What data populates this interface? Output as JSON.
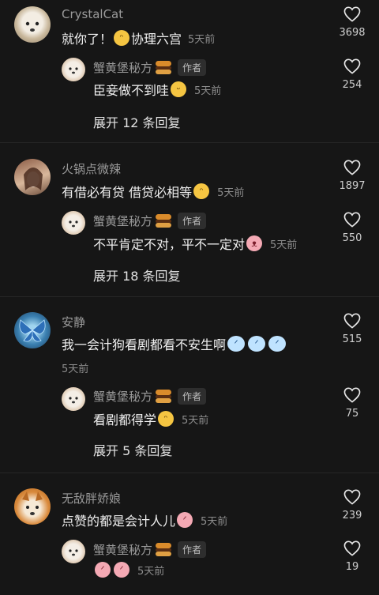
{
  "comments": [
    {
      "user": "CrystalCat",
      "text": "就你了！",
      "text2": "协理六宫",
      "time": "5天前",
      "likes": "3698",
      "reply": {
        "user": "蟹黄堡秘方",
        "badge": "作者",
        "text": "臣妾做不到哇",
        "time": "5天前",
        "likes": "254"
      },
      "expand": "展开 12 条回复"
    },
    {
      "user": "火锅点微辣",
      "text": "有借必有贷 借贷必相等",
      "time": "5天前",
      "likes": "1897",
      "reply": {
        "user": "蟹黄堡秘方",
        "badge": "作者",
        "text": "不平肯定不对，平不一定对",
        "time": "5天前",
        "likes": "550"
      },
      "expand": "展开 18 条回复"
    },
    {
      "user": "安静",
      "text": "我一会计狗看剧都看不安生啊",
      "time": "5天前",
      "likes": "515",
      "reply": {
        "user": "蟹黄堡秘方",
        "badge": "作者",
        "text": "看剧都得学",
        "time": "5天前",
        "likes": "75"
      },
      "expand": "展开 5 条回复"
    },
    {
      "user": "无敌胖娇娘",
      "text": "点赞的都是会计人儿",
      "time": "5天前",
      "likes": "239",
      "reply": {
        "user": "蟹黄堡秘方",
        "badge": "作者",
        "text": "",
        "time": "5天前",
        "likes": "19"
      }
    }
  ],
  "icons": {
    "like": "heart-outline-icon",
    "burger": "burger-emoji-icon"
  },
  "colors": {
    "background": "#161616",
    "username": "#9a9a9a",
    "text": "#f0f0f0"
  }
}
